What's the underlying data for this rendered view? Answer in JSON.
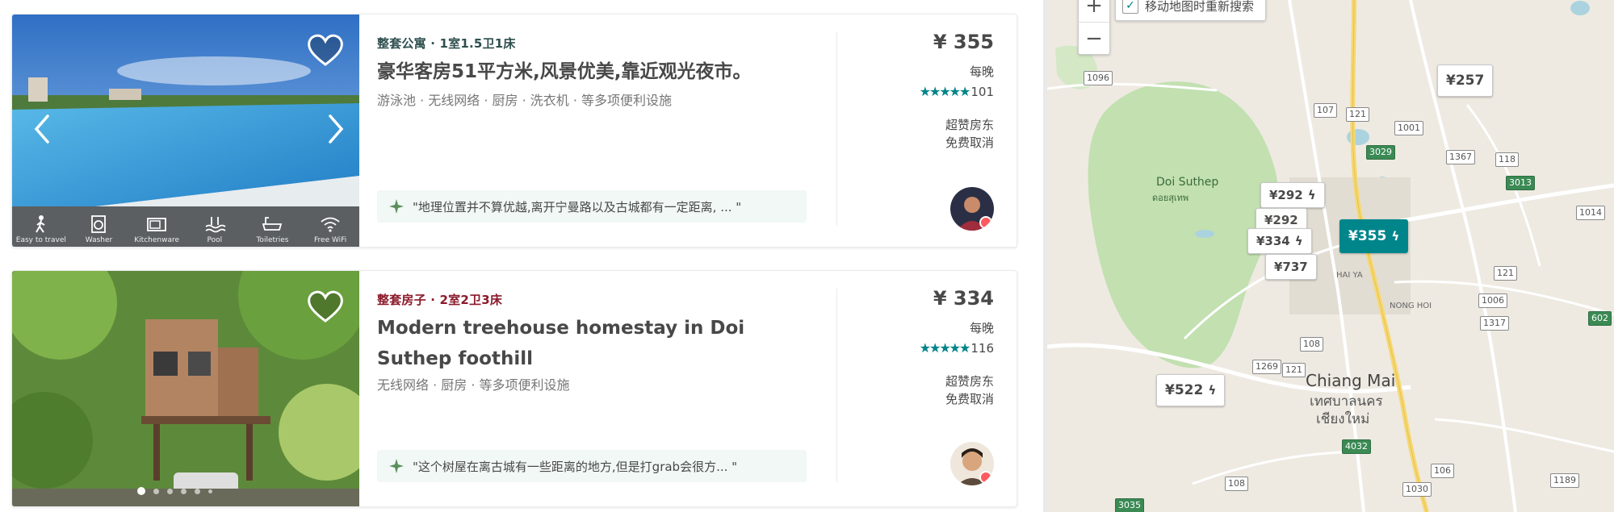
{
  "listings": [
    {
      "kicker": "整套公寓 · 1室1.5卫1床",
      "kicker_color": "#2f4f4f",
      "title": "豪华客房51平方米,风景优美,靠近观光夜市。",
      "features": "游泳池 · 无线网络 · 厨房 · 洗衣机 · 等多项便利设施",
      "review": "\"地理位置并不算优越,离开宁曼路以及古城都有一定距离, ... \"",
      "price": "¥ 355",
      "per_night": "每晚",
      "stars": "★★★★★",
      "rating_count": "101",
      "superhost": "超赞房东",
      "cancel": "免费取消",
      "amenities": [
        "Easy to travel",
        "Washer",
        "Kitchenware",
        "Pool",
        "Toiletries",
        "Free WiFi"
      ]
    },
    {
      "kicker": "整套房子 · 2室2卫3床",
      "kicker_color": "#8b1a2b",
      "title": "Modern treehouse homestay in Doi Suthep foothill",
      "features": "无线网络 · 厨房 · 等多项便利设施",
      "review": "\"这个树屋在离古城有一些距离的地方,但是打grab会很方... \"",
      "price": "¥ 334",
      "per_night": "每晚",
      "stars": "★★★★★",
      "rating_count": "116",
      "superhost": "超赞房东",
      "cancel": "免费取消"
    }
  ],
  "map": {
    "zoom_in": "+",
    "zoom_out": "−",
    "redo_search_label": "移动地图时重新搜索",
    "place_doi_suthep": "Doi Suthep",
    "place_doi_suthep_thai": "ดอยสุเทพ",
    "place_chiang_mai": "Chiang Mai",
    "place_chiang_mai_thai_1": "เทศบาลนคร",
    "place_chiang_mai_thai_2": "เชียงใหม่",
    "place_hai_ya": "HAI YA",
    "place_nong_hoi": "NONG HOI",
    "markers": [
      "¥257",
      "¥292",
      "¥334",
      "¥737",
      "¥355",
      "¥522"
    ],
    "route_shields": [
      "1096",
      "107",
      "121",
      "1001",
      "1367",
      "118",
      "3029",
      "3013",
      "1014",
      "121",
      "1006",
      "1317",
      "108",
      "1269",
      "121",
      "108",
      "1030",
      "4032",
      "106",
      "1189",
      "3035",
      "602"
    ]
  },
  "colors": {
    "accent": "#008489",
    "marker_active": "#00868a",
    "map_green": "#c2e0b0"
  }
}
